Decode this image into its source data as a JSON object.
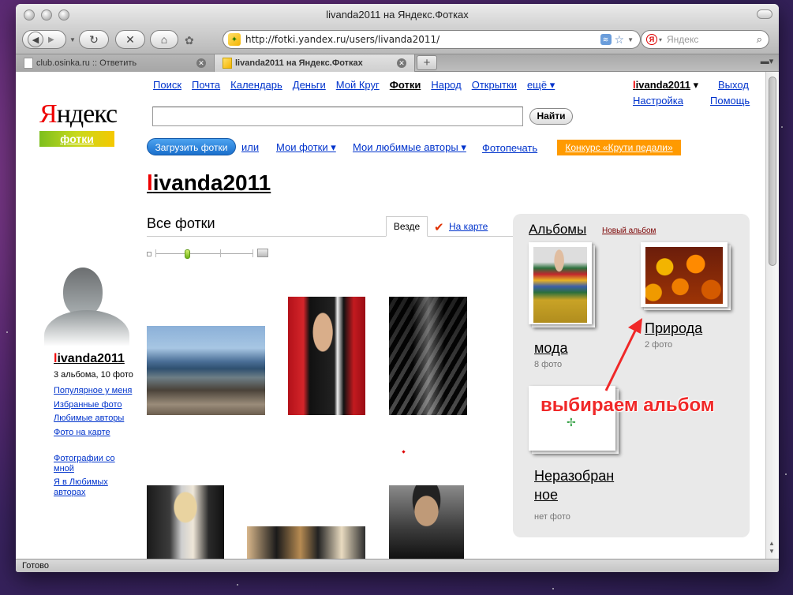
{
  "window": {
    "title": "livanda2011 на Яндекс.Фотках",
    "status": "Готово"
  },
  "toolbar": {
    "url": "http://fotki.yandex.ru/users/livanda2011/",
    "search_placeholder": "Яндекс"
  },
  "tabs": [
    {
      "label": "club.osinka.ru :: Ответить"
    },
    {
      "label": "livanda2011 на Яндекс.Фотках"
    }
  ],
  "logo": {
    "yandex_first": "Я",
    "yandex_rest": "ндекс",
    "service": "фотки"
  },
  "topnav": [
    "Поиск",
    "Почта",
    "Календарь",
    "Деньги",
    "Мой Круг",
    "Фотки",
    "Народ",
    "Открытки",
    "ещё ▾"
  ],
  "user": {
    "first_letter": "l",
    "rest": "ivanda2011",
    "caret": "▾",
    "settings": "Настройка",
    "logout": "Выход",
    "help": "Помощь"
  },
  "search": {
    "button": "Найти"
  },
  "actions": {
    "upload": "Загрузить фотки",
    "or": "или",
    "my_photos": "Мои фотки ▾",
    "favorite_authors": "Мои любимые авторы ▾",
    "photo_print": "Фотопечать",
    "contest": "Конкурс «Крути педали»"
  },
  "main": {
    "section_title": "Все фотки",
    "tab_everywhere": "Везде",
    "tab_map": "На карте"
  },
  "sidebar": {
    "stats": "3 альбома, 10 фото",
    "links": [
      "Популярное у меня",
      "Избранные фото",
      "Любимые авторы",
      "Фото на карте"
    ],
    "links2": [
      "Фотографии со мной",
      "Я в Любимых авторах"
    ]
  },
  "albums": {
    "title": "Альбомы",
    "new_album": "Новый альбом",
    "items": [
      {
        "name": "мода",
        "count": "8 фото"
      },
      {
        "name": "Природа",
        "count": "2 фото"
      },
      {
        "name": "Неразобран ное",
        "name_line1": "Неразобран",
        "name_line2": "ное",
        "count": "нет фото"
      }
    ]
  },
  "annotation": "выбираем альбом",
  "colors": {
    "link": "#0033cc",
    "brand_red": "#e00000",
    "contest_orange": "#ff9a00",
    "upload_blue": "#1a6fcc",
    "annotation_red": "#f02828"
  }
}
